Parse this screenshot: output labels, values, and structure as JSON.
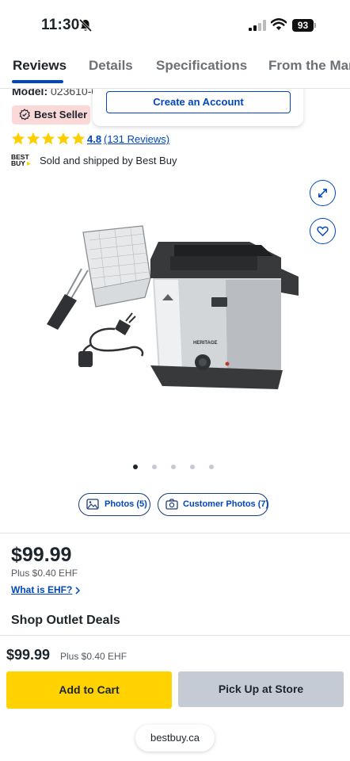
{
  "status_bar": {
    "time": "11:30",
    "battery": "93"
  },
  "tabs": [
    {
      "label": "Reviews",
      "active": true
    },
    {
      "label": "Details",
      "active": false
    },
    {
      "label": "Specifications",
      "active": false
    },
    {
      "label": "From the Man",
      "active": false
    }
  ],
  "product": {
    "model_label": "Model:",
    "model_value": "023610-00",
    "badge": "Best Seller",
    "rating": "4.8",
    "review_count": "(131 Reviews)",
    "stars": 5,
    "seller_text": "Sold and shipped by Best Buy",
    "image_name": "HERITAGE"
  },
  "account_popup": {
    "button_label": "Create an Account"
  },
  "gallery": {
    "dot_count": 5,
    "active_dot": 0
  },
  "media_buttons": {
    "photos": "Photos (5)",
    "customer_photos": "Customer Photos (7)"
  },
  "pricing": {
    "price": "$99.99",
    "ehf": "Plus $0.40 EHF",
    "ehf_link": "What is EHF?",
    "outlet_heading": "Shop Outlet Deals"
  },
  "bottom_bar": {
    "price": "$99.99",
    "ehf": "Plus $0.40 EHF",
    "add_to_cart": "Add to Cart",
    "pick_up": "Pick Up at Store",
    "url": "bestbuy.ca"
  },
  "colors": {
    "brand_blue": "#0046be",
    "brand_yellow": "#ffd200",
    "star_yellow": "#ffce00",
    "badge_pink": "#fbd9d9"
  }
}
